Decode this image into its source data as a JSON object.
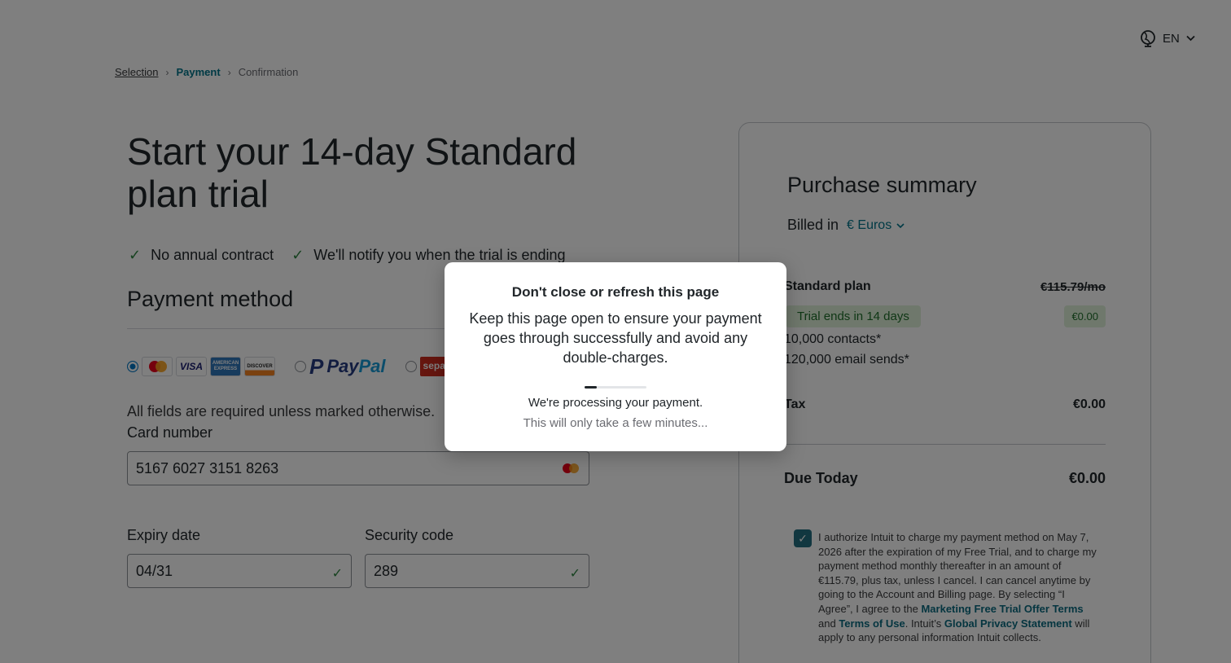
{
  "header": {
    "language": "EN"
  },
  "breadcrumb": {
    "step1": "Selection",
    "step2": "Payment",
    "step3": "Confirmation"
  },
  "page": {
    "title": "Start your 14-day Standard plan trial",
    "benefits": [
      "No annual contract",
      "We'll notify you when the trial is ending"
    ]
  },
  "payment": {
    "title": "Payment method",
    "card_brands": {
      "visa": "VISA",
      "amex": "AMERICAN EXPRESS",
      "discover": "DISCOVER"
    },
    "paypal": {
      "pay": "Pay",
      "pal": "Pal"
    },
    "sepa": "sepa",
    "required_note": "All fields are required unless marked otherwise.",
    "card_number": {
      "label": "Card number",
      "value": "5167 6027 3151 8263"
    },
    "expiry": {
      "label": "Expiry date",
      "value": "04/31"
    },
    "security": {
      "label": "Security code",
      "value": "289"
    }
  },
  "summary": {
    "title": "Purchase summary",
    "billed_in": "Billed in",
    "currency": "€ Euros",
    "plan_name": "Standard plan",
    "plan_price": "€115.79/mo",
    "trial_badge": "Trial ends in 14 days",
    "trial_price": "€0.00",
    "features": [
      "10,000 contacts*",
      "120,000 email sends*"
    ],
    "tax_label": "Tax",
    "tax_value": "€0.00",
    "due_label": "Due Today",
    "due_value": "€0.00",
    "consent": {
      "text1": "I authorize Intuit to charge my payment method on May 7, 2026 after the expiration of my Free Trial, and to charge my payment method monthly thereafter in an amount of €115.79, plus tax, unless I cancel. I can cancel anytime by going to the Account and Billing page. By selecting “I Agree”, I agree to the ",
      "link1": "Marketing Free Trial Offer Terms",
      "text2": " and ",
      "link2": "Terms of Use",
      "text3": ". Intuit’s ",
      "link3": "Global Privacy Statement",
      "text4": " will apply to any personal information Intuit collects."
    }
  },
  "modal": {
    "title": "Don't close or refresh this page",
    "body": "Keep this page open to ensure your payment goes through successfully and avoid any double-charges.",
    "progress": 0.2,
    "status": "We're processing your payment.",
    "sub": "This will only take a few minutes..."
  },
  "colors": {
    "accent": "#00758a",
    "success": "#2e8540",
    "checkbox": "#236f80"
  }
}
